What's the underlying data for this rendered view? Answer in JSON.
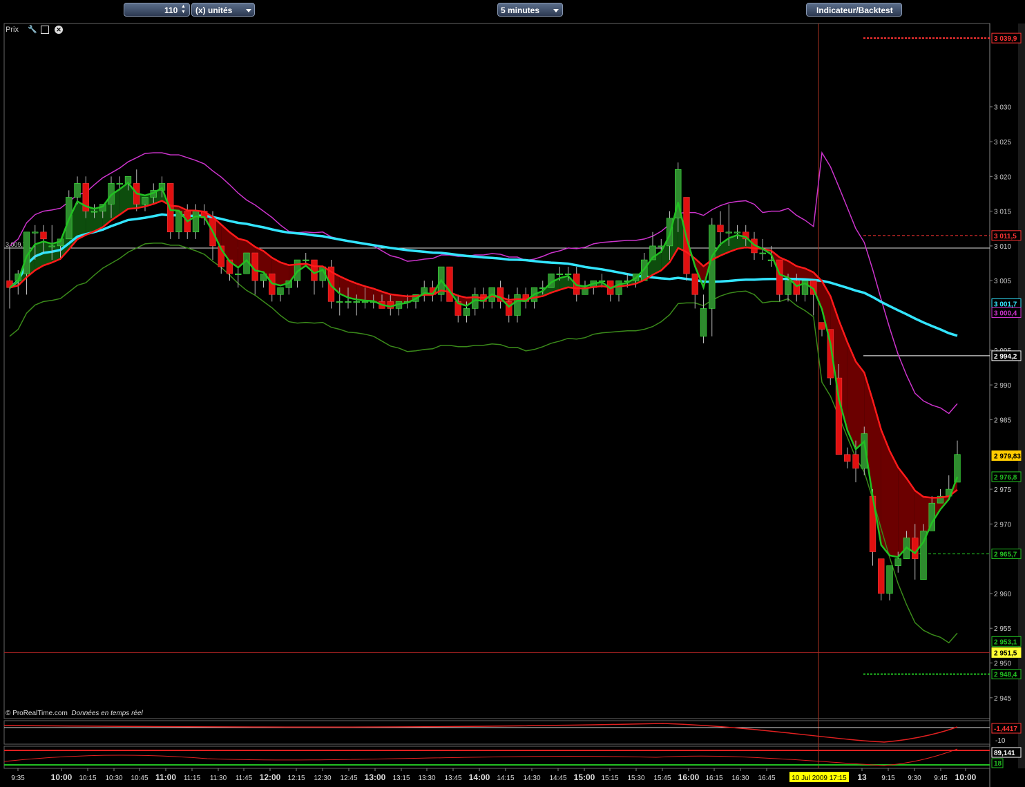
{
  "toolbar": {
    "units_value": "110",
    "units_label": "(x) unités",
    "timeframe": "5 minutes",
    "indicator_button": "Indicateur/Backtest"
  },
  "panel": {
    "title": "Prix"
  },
  "credit": {
    "brand": "© ProRealTime.com",
    "note": "Données en temps réel"
  },
  "colors": {
    "background": "#000000",
    "bull_candle": "#2e8b2e",
    "bear_candle": "#e01010",
    "ma_red": "#ff1a1a",
    "ma_green": "#22c022",
    "ma_cyan": "#33e5ff",
    "band_upper": "#cc33cc",
    "band_lower": "#3a8a1a"
  },
  "chart_data": {
    "type": "candlestick",
    "y_axis": {
      "ticks": [
        "3 030",
        "3 025",
        "3 020",
        "3 015",
        "3 010",
        "3 005",
        "2 995",
        "2 990",
        "2 985",
        "2 975",
        "2 970",
        "2 960",
        "2 955",
        "2 950",
        "2 945"
      ],
      "tick_values": [
        3030,
        3025,
        3020,
        3015,
        3010,
        3005,
        2995,
        2990,
        2985,
        2975,
        2970,
        2960,
        2955,
        2950,
        2945
      ],
      "range": [
        2942,
        3042
      ]
    },
    "x_axis": {
      "labels": [
        "9:35",
        "10:00",
        "10:15",
        "10:30",
        "10:45",
        "11:00",
        "11:15",
        "11:30",
        "11:45",
        "12:00",
        "12:15",
        "12:30",
        "12:45",
        "13:00",
        "13:15",
        "13:30",
        "13:45",
        "14:00",
        "14:15",
        "14:30",
        "14:45",
        "15:00",
        "15:15",
        "15:30",
        "15:45",
        "16:00",
        "16:15",
        "16:30",
        "16:45",
        "13",
        "9:15",
        "9:30",
        "9:45",
        "10:00"
      ],
      "bold_labels": [
        "10:00",
        "11:00",
        "12:00",
        "13:00",
        "14:00",
        "15:00",
        "16:00",
        "13",
        "10:00"
      ],
      "cursor_label": "10 Jul 2009 17:15"
    },
    "price_tags": [
      {
        "label": "3 039,9",
        "value": 3039.9,
        "color": "#ff3333",
        "style": "dotted"
      },
      {
        "label": "3 011,5",
        "value": 3011.5,
        "color": "#ff3333",
        "style": "dashed"
      },
      {
        "label": "3 001,7",
        "value": 3001.7,
        "color": "#33e5ff",
        "style": "none"
      },
      {
        "label": "3 000,4",
        "value": 3000.4,
        "color": "#cc33cc",
        "style": "none"
      },
      {
        "label": "2 994,2",
        "value": 2994.2,
        "color": "#ffffff",
        "style": "solid"
      },
      {
        "label": "2 979,83",
        "value": 2979.83,
        "color": "#ffcc00",
        "style": "none"
      },
      {
        "label": "2 976,8",
        "value": 2976.8,
        "color": "#22c022",
        "style": "none"
      },
      {
        "label": "2 965,7",
        "value": 2965.7,
        "color": "#22c022",
        "style": "dashed"
      },
      {
        "label": "2 953,1",
        "value": 2953.1,
        "color": "#22c022",
        "style": "none"
      },
      {
        "label": "2 951,5",
        "value": 2951.5,
        "color": "#ffff33",
        "style": "none"
      },
      {
        "label": "2 948,4",
        "value": 2948.4,
        "color": "#22c022",
        "style": "dotted"
      }
    ],
    "hline": {
      "label": "3 009,7",
      "value": 3009.7
    },
    "candles": [
      [
        3005,
        3010,
        3004,
        3001
      ],
      [
        3005,
        3006.5,
        3006,
        3003
      ],
      [
        3006,
        3012,
        3012,
        3003
      ],
      [
        3012,
        3013,
        3012,
        3008
      ],
      [
        3012,
        3013,
        3011,
        3009
      ],
      [
        3010,
        3013,
        3010,
        3008
      ],
      [
        3010,
        3011,
        3011,
        3008
      ],
      [
        3011,
        3018,
        3017,
        3011
      ],
      [
        3017,
        3020,
        3019,
        3016
      ],
      [
        3019,
        3020,
        3015,
        3014
      ],
      [
        3015,
        3016,
        3015,
        3014
      ],
      [
        3015,
        3016,
        3016,
        3014
      ],
      [
        3016,
        3020,
        3019,
        3014
      ],
      [
        3019,
        3020,
        3019,
        3018
      ],
      [
        3019,
        3020,
        3020,
        3018
      ],
      [
        3019,
        3021,
        3016,
        3015
      ],
      [
        3016,
        3017,
        3017,
        3015
      ],
      [
        3017,
        3019,
        3018,
        3016
      ],
      [
        3018,
        3020,
        3019,
        3017
      ],
      [
        3019,
        3019,
        3012,
        3011
      ],
      [
        3012,
        3015,
        3015,
        3011
      ],
      [
        3015,
        3016,
        3012,
        3011
      ],
      [
        3012,
        3016,
        3015,
        3011
      ],
      [
        3015,
        3016,
        3014,
        3013
      ],
      [
        3014,
        3015,
        3010,
        3008
      ],
      [
        3010,
        3008,
        3007,
        3006
      ],
      [
        3008,
        3008,
        3006,
        3005
      ],
      [
        3006,
        3007,
        3006,
        3004
      ],
      [
        3006,
        3009,
        3009,
        3006
      ],
      [
        3009,
        3009,
        3005,
        3003
      ],
      [
        3005,
        3006,
        3006,
        3004
      ],
      [
        3006,
        3006,
        3003,
        3002
      ],
      [
        3003,
        3004,
        3004,
        3002
      ],
      [
        3004,
        3005,
        3005,
        3003
      ],
      [
        3005,
        3008,
        3008,
        3004
      ],
      [
        3008,
        3009,
        3008,
        3007
      ],
      [
        3008,
        3008,
        3005,
        3003
      ],
      [
        3005,
        3007,
        3007,
        3004
      ],
      [
        3007,
        3008,
        3002,
        3001
      ],
      [
        3002,
        3004,
        3002,
        3000
      ],
      [
        3002,
        3004,
        3002,
        3001
      ],
      [
        3002,
        3003,
        3002,
        3000
      ],
      [
        3002,
        3004,
        3002,
        3001
      ],
      [
        3002,
        3003,
        3002,
        3001
      ],
      [
        3002,
        3003,
        3001,
        3001
      ],
      [
        3002,
        3003,
        3001,
        3000
      ],
      [
        3001,
        3002,
        3002,
        3000
      ],
      [
        3002,
        3003,
        3002,
        3001
      ],
      [
        3002,
        3003,
        3003,
        3001
      ],
      [
        3003,
        3005,
        3004,
        3002
      ],
      [
        3004,
        3005,
        3003,
        3002
      ],
      [
        3003,
        3007,
        3007,
        3002
      ],
      [
        3007,
        3007,
        3002,
        3002
      ],
      [
        3002,
        3003,
        3000,
        2999
      ],
      [
        3000,
        3002,
        3001,
        2999
      ],
      [
        3001,
        3004,
        3003,
        3000
      ],
      [
        3003,
        3004,
        3002,
        3001
      ],
      [
        3002,
        3004,
        3004,
        3001
      ],
      [
        3004,
        3005,
        3002,
        3001
      ],
      [
        3002,
        3003,
        3000,
        2999
      ],
      [
        3000,
        3004,
        3003,
        2999
      ],
      [
        3003,
        3004,
        3002,
        3001
      ],
      [
        3002,
        3004,
        3004,
        3001
      ],
      [
        3004,
        3005,
        3004,
        3003
      ],
      [
        3004,
        3006,
        3006,
        3004
      ],
      [
        3006,
        3007,
        3006,
        3005
      ],
      [
        3006,
        3007,
        3006,
        3005
      ],
      [
        3006,
        3007,
        3003,
        3002
      ],
      [
        3003,
        3005,
        3004,
        3003
      ],
      [
        3004,
        3005,
        3005,
        3003
      ],
      [
        3005,
        3006,
        3005,
        3004
      ],
      [
        3005,
        3005,
        3003,
        3002
      ],
      [
        3003,
        3005,
        3005,
        3002
      ],
      [
        3005,
        3006,
        3005,
        3004
      ],
      [
        3005,
        3006,
        3006,
        3004
      ],
      [
        3005,
        3009,
        3008,
        3005
      ],
      [
        3008,
        3012,
        3010,
        3008
      ],
      [
        3010,
        3011,
        3010,
        3009
      ],
      [
        3010,
        3015,
        3014,
        3008
      ],
      [
        3014,
        3022,
        3021,
        3012
      ],
      [
        3017,
        3016,
        3006,
        3005
      ],
      [
        3006,
        3006,
        3003,
        3001
      ],
      [
        2997,
        3003,
        3001,
        2996
      ],
      [
        3001,
        3014,
        3013,
        2997
      ],
      [
        3013,
        3015,
        3012,
        3010
      ],
      [
        3012,
        3016,
        3012,
        3010
      ],
      [
        3012,
        3013,
        3012,
        3011
      ],
      [
        3012,
        3013,
        3011,
        3010
      ],
      [
        3011,
        3012,
        3009,
        3008
      ],
      [
        3009,
        3011,
        3009,
        3008
      ],
      [
        3008,
        3010,
        3008,
        3007
      ],
      [
        3008,
        3007,
        3003,
        3002
      ],
      [
        3003,
        3006,
        3005,
        3002
      ],
      [
        3005,
        3006,
        3003,
        3002
      ],
      [
        3003,
        3005,
        3005,
        3002
      ],
      [
        3005,
        3005,
        3003,
        3000
      ],
      [
        2999,
        2999,
        2998,
        2997
      ],
      [
        2998,
        2998,
        2991,
        2990
      ],
      [
        2991,
        2993,
        2980,
        2980
      ],
      [
        2980,
        2981,
        2979,
        2978
      ],
      [
        2980,
        2982,
        2978,
        2976
      ],
      [
        2978,
        2984,
        2983,
        2977
      ],
      [
        2974,
        2975,
        2966,
        2964
      ],
      [
        2965,
        2965,
        2960,
        2959
      ],
      [
        2960,
        2964,
        2964,
        2959
      ],
      [
        2964,
        2966,
        2965,
        2963
      ],
      [
        2965,
        2969,
        2968,
        2965
      ],
      [
        2968,
        2970,
        2965,
        2962
      ],
      [
        2962,
        2970,
        2969,
        2962
      ],
      [
        2969,
        2974,
        2973,
        2969
      ],
      [
        2973,
        2975,
        2974,
        2973
      ],
      [
        2974,
        2977,
        2975,
        2974
      ],
      [
        2976,
        2982,
        2980,
        2976
      ]
    ]
  }
}
